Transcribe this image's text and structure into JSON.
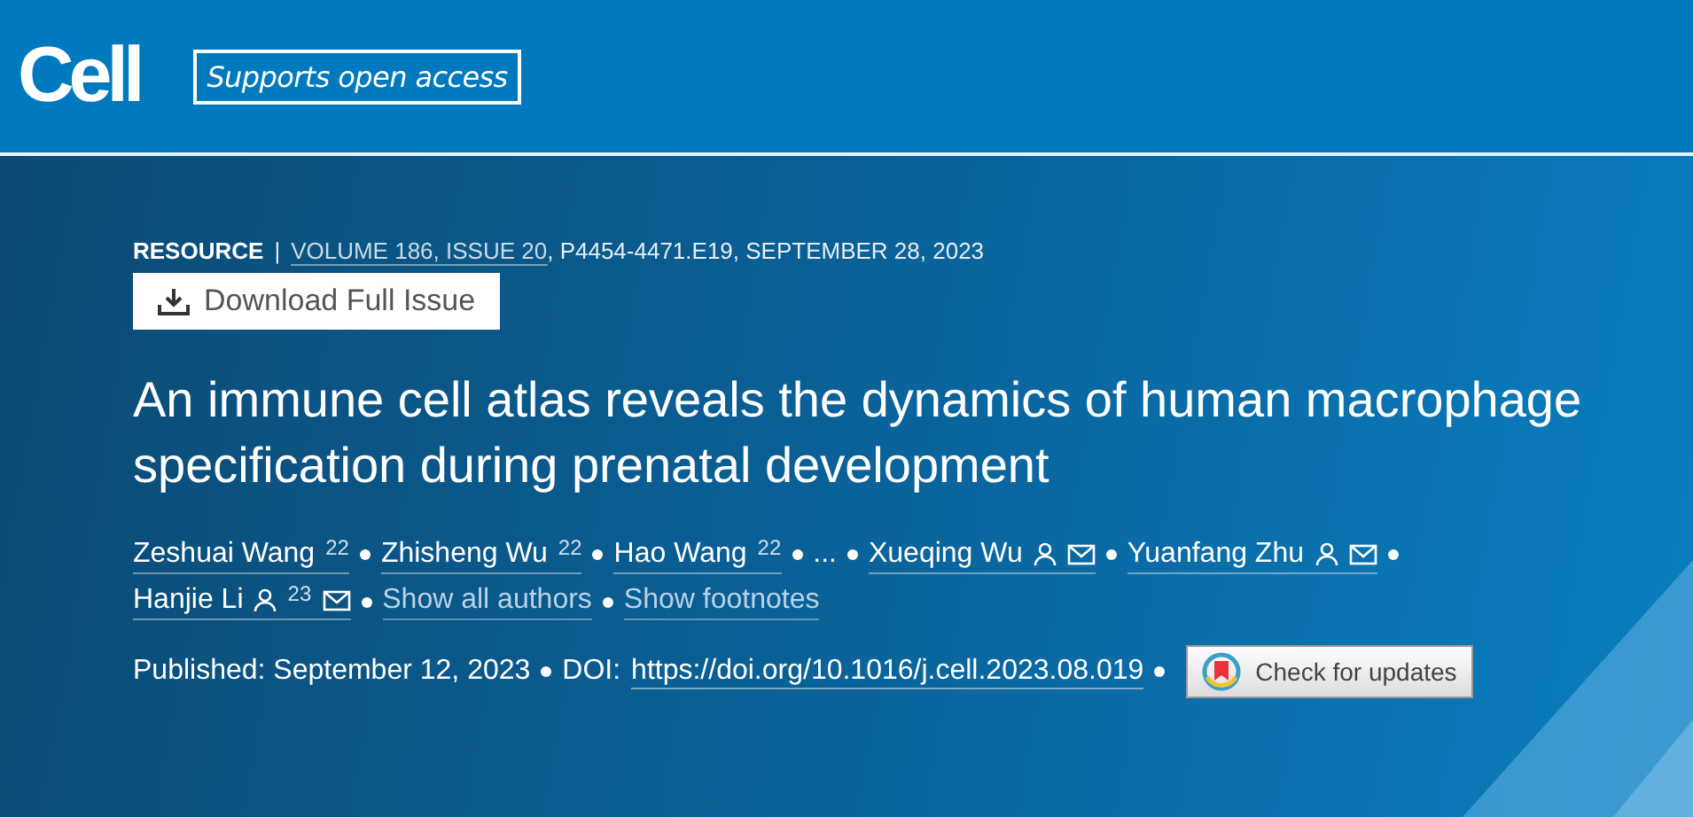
{
  "header": {
    "logo": "Cell",
    "badge": "Supports open access"
  },
  "meta": {
    "type": "RESOURCE",
    "separator": "|",
    "issue_link": "VOLUME 186, ISSUE 20",
    "details": ", P4454-4471.E19, SEPTEMBER 28, 2023"
  },
  "download_button": {
    "label": "Download Full Issue"
  },
  "title": "An immune cell atlas reveals the dynamics of human macrophage specification during prenatal development",
  "authors": [
    {
      "kind": "author",
      "name": "Zeshuai Wang",
      "note": "22",
      "corresponding": false
    },
    {
      "kind": "author",
      "name": "Zhisheng Wu",
      "note": "22",
      "corresponding": false
    },
    {
      "kind": "author",
      "name": "Hao Wang",
      "note": "22",
      "corresponding": false
    },
    {
      "kind": "more",
      "name": "..."
    },
    {
      "kind": "author",
      "name": "Xueqing Wu",
      "corresponding": true
    },
    {
      "kind": "author",
      "name": "Yuanfang Zhu",
      "corresponding": true
    },
    {
      "kind": "author",
      "name": "Hanjie Li",
      "note": "23",
      "corresponding": true
    },
    {
      "kind": "link",
      "name": "Show all authors"
    },
    {
      "kind": "link",
      "name": "Show footnotes"
    }
  ],
  "publication": {
    "published": "Published: September 12, 2023",
    "doi_label": "DOI:",
    "doi_link": "https://doi.org/10.1016/j.cell.2023.08.019",
    "update_button": "Check for updates"
  }
}
